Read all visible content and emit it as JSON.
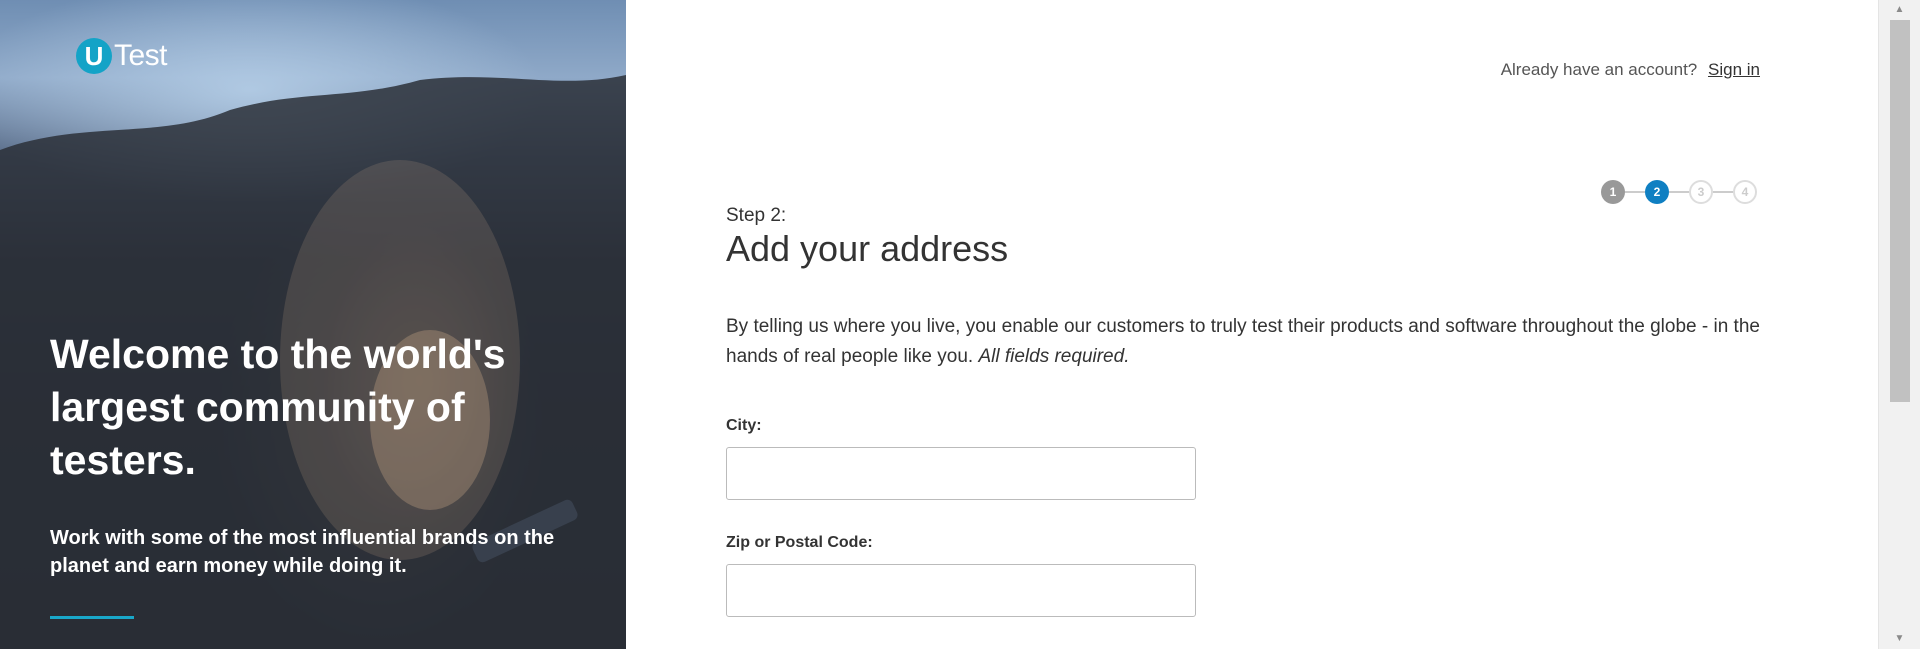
{
  "hero": {
    "logo_mark": "U",
    "logo_text": "Test",
    "title": "Welcome to the world's largest community of testers.",
    "subtitle": "Work with some of the most influential brands on the planet and earn money while doing it."
  },
  "header": {
    "account_prompt": "Already have an account?",
    "signin_label": "Sign in"
  },
  "stepper": {
    "steps": [
      "1",
      "2",
      "3",
      "4"
    ],
    "current": 2
  },
  "form": {
    "step_label": "Step 2:",
    "title": "Add your address",
    "intro": "By telling us where you live, you enable our customers to truly test their products and software throughout the globe - in the hands of real people like you.",
    "intro_emphasis": "All fields required.",
    "city_label": "City:",
    "city_value": "",
    "zip_label": "Zip or Postal Code:",
    "zip_value": ""
  },
  "colors": {
    "accent": "#0f7fc2",
    "brand_teal": "#14a3c7"
  }
}
